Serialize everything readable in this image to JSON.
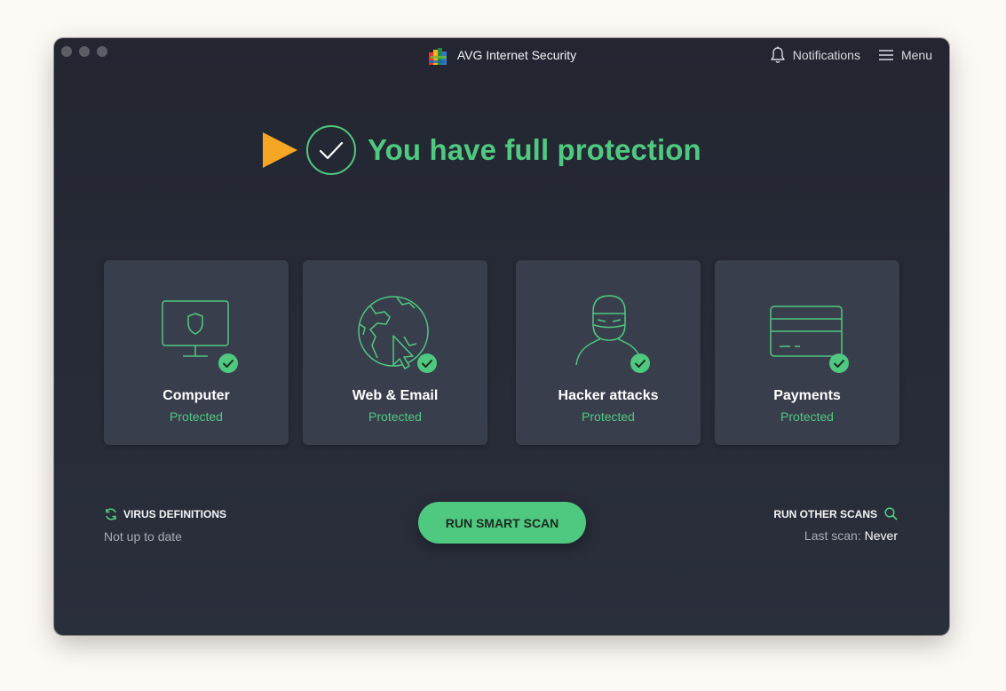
{
  "app": {
    "title": "AVG Internet Security"
  },
  "header": {
    "notifications_label": "Notifications",
    "menu_label": "Menu"
  },
  "hero": {
    "status_text": "You have full protection"
  },
  "cards": [
    {
      "title": "Computer",
      "status": "Protected",
      "icon": "monitor-shield-icon"
    },
    {
      "title": "Web & Email",
      "status": "Protected",
      "icon": "globe-cursor-icon"
    },
    {
      "title": "Hacker attacks",
      "status": "Protected",
      "icon": "hacker-icon"
    },
    {
      "title": "Payments",
      "status": "Protected",
      "icon": "credit-card-icon"
    }
  ],
  "virus_definitions": {
    "title": "VIRUS DEFINITIONS",
    "status": "Not up to date"
  },
  "scan_button": {
    "label": "RUN SMART SCAN"
  },
  "other_scans": {
    "title": "RUN OTHER SCANS",
    "last_scan_label": "Last scan:",
    "last_scan_value": "Never"
  },
  "colors": {
    "accent_green": "#4fc97f",
    "arrow_orange": "#f5a623",
    "background": "#262a36",
    "card": "#393e4d"
  }
}
